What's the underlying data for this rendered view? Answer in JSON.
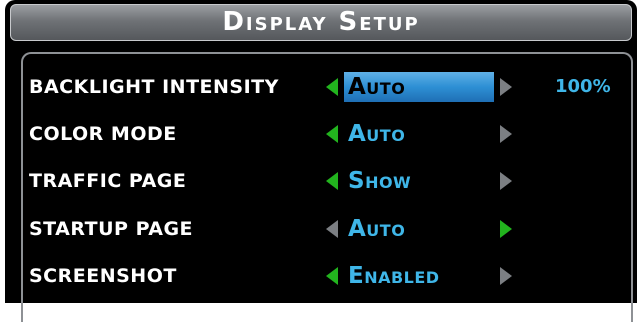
{
  "window": {
    "title": "Display Setup"
  },
  "settings": [
    {
      "label": "BACKLIGHT INTENSITY",
      "value": "Auto",
      "extra": "100%",
      "left_arrow": "arrow-left-icon",
      "right_arrow": "arrow-right-icon"
    },
    {
      "label": "COLOR MODE",
      "value": "Auto",
      "left_arrow": "arrow-left-icon",
      "right_arrow": "arrow-right-icon"
    },
    {
      "label": "TRAFFIC PAGE",
      "value": "Show",
      "left_arrow": "arrow-left-icon",
      "right_arrow": "arrow-right-icon"
    },
    {
      "label": "STARTUP PAGE",
      "value": "Auto",
      "left_arrow": "arrow-left-icon",
      "right_arrow": "arrow-right-icon"
    },
    {
      "label": "SCREENSHOT",
      "value": "Enabled",
      "left_arrow": "arrow-left-icon",
      "right_arrow": "arrow-right-icon"
    }
  ],
  "colors": {
    "background": "#000000",
    "label_text": "#ffffff",
    "value_text": "#3fb6e8",
    "selected_highlight": "#2d8fd4",
    "arrow_active": "#22b41e",
    "arrow_inactive": "#7c7f83",
    "title_bar": "#6f7276"
  }
}
